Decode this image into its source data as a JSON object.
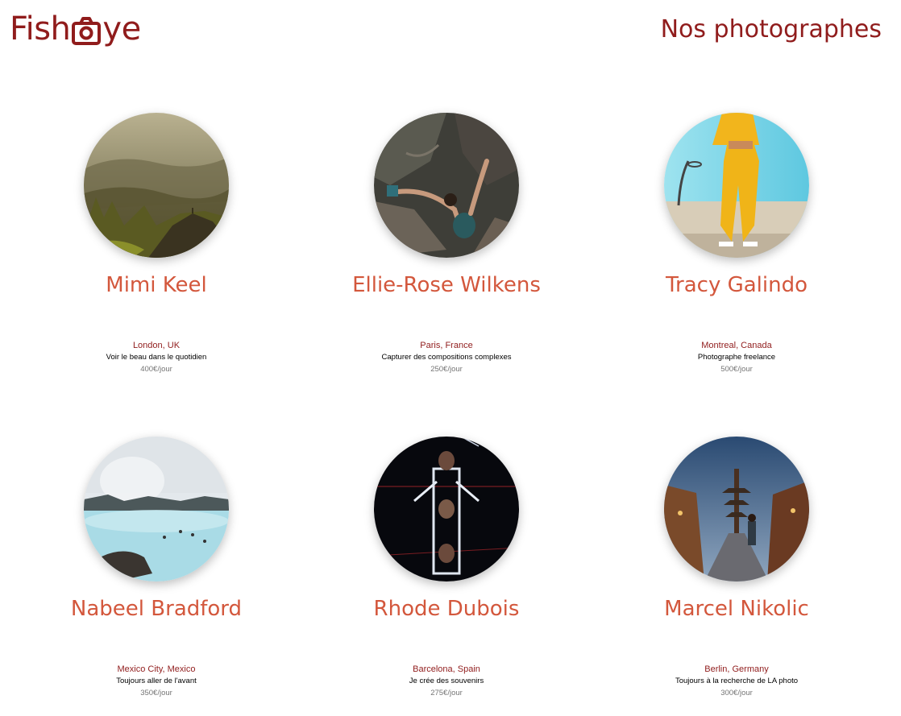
{
  "header": {
    "logo_left": "Fish",
    "logo_right": "ye",
    "logo_icon": "camera-icon",
    "title": "Nos photographes"
  },
  "photographers": [
    {
      "name": "Mimi Keel",
      "city": "London, UK",
      "tagline": "Voir le beau dans le quotidien",
      "price": "400€/jour",
      "photo": "mountain-landscape"
    },
    {
      "name": "Ellie-Rose Wilkens",
      "city": "Paris, France",
      "tagline": "Capturer des compositions complexes",
      "price": "250€/jour",
      "photo": "rock-climber"
    },
    {
      "name": "Tracy Galindo",
      "city": "Montreal, Canada",
      "tagline": "Photographe freelance",
      "price": "500€/jour",
      "photo": "yellow-outfit-basketball-court"
    },
    {
      "name": "Nabeel Bradford",
      "city": "Mexico City, Mexico",
      "tagline": "Toujours aller de l'avant",
      "price": "350€/jour",
      "photo": "blue-lagoon"
    },
    {
      "name": "Rhode Dubois",
      "city": "Barcelona, Spain",
      "tagline": "Je crée des souvenirs",
      "price": "275€/jour",
      "photo": "rowers-aerial"
    },
    {
      "name": "Marcel Nikolic",
      "city": "Berlin, Germany",
      "tagline": "Toujours à la recherche de LA photo",
      "price": "300€/jour",
      "photo": "kyoto-street"
    }
  ],
  "colors": {
    "brand": "#901c1c",
    "name": "#d3573c",
    "price": "#757575"
  }
}
